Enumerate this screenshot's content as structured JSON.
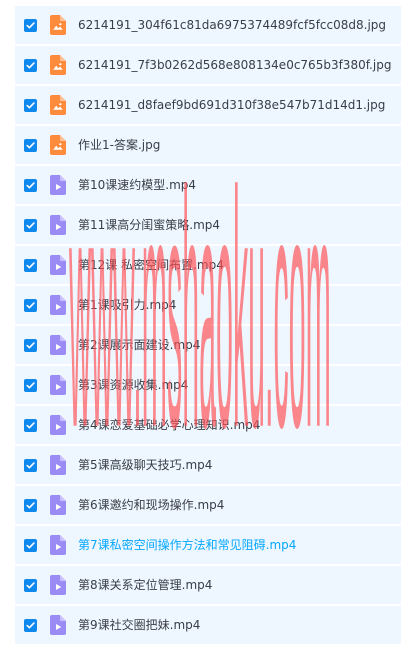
{
  "files": [
    {
      "name": "6214191_304f61c81da6975374489fcf5fcc08d8.jpg",
      "type": "image",
      "checked": true,
      "active": false
    },
    {
      "name": "6214191_7f3b0262d568e808134e0c765b3f380f.jpg",
      "type": "image",
      "checked": true,
      "active": false
    },
    {
      "name": "6214191_d8faef9bd691d310f38e547b71d14d1.jpg",
      "type": "image",
      "checked": true,
      "active": false
    },
    {
      "name": "作业1-答案.jpg",
      "type": "image",
      "checked": true,
      "active": false
    },
    {
      "name": "第10课速约模型.mp4",
      "type": "video",
      "checked": true,
      "active": false
    },
    {
      "name": "第11课高分闺蜜策略.mp4",
      "type": "video",
      "checked": true,
      "active": false
    },
    {
      "name": "第12课 私密空间布置.mp4",
      "type": "video",
      "checked": true,
      "active": false
    },
    {
      "name": "第1课吸引力.mp4",
      "type": "video",
      "checked": true,
      "active": false
    },
    {
      "name": "第2课展示面建设.mp4",
      "type": "video",
      "checked": true,
      "active": false
    },
    {
      "name": "第3课资源收集.mp4",
      "type": "video",
      "checked": true,
      "active": false
    },
    {
      "name": "第4课恋爱基础必学心理知识.mp4",
      "type": "video",
      "checked": true,
      "active": false
    },
    {
      "name": "第5课高级聊天技巧.mp4",
      "type": "video",
      "checked": true,
      "active": false
    },
    {
      "name": "第6课邀约和现场操作.mp4",
      "type": "video",
      "checked": true,
      "active": false
    },
    {
      "name": "第7课私密空间操作方法和常见阻碍.mp4",
      "type": "video",
      "checked": true,
      "active": true
    },
    {
      "name": "第8课关系定位管理.mp4",
      "type": "video",
      "checked": true,
      "active": false
    },
    {
      "name": "第9课社交圈把妹.mp4",
      "type": "video",
      "checked": true,
      "active": false
    }
  ],
  "icons": {
    "image": "image-file-icon",
    "video": "video-file-icon",
    "checkbox": "checkbox-checked-icon"
  },
  "colors": {
    "row_background": "#eef7ff",
    "checkbox": "#0d88ee",
    "text": "#3a3d45",
    "active_text": "#06a7ff",
    "image_icon": "#ff8b3d",
    "video_icon": "#9b8cf5",
    "watermark": "#ff4f55"
  },
  "watermark": {
    "text": "www.mshaoku.com"
  }
}
